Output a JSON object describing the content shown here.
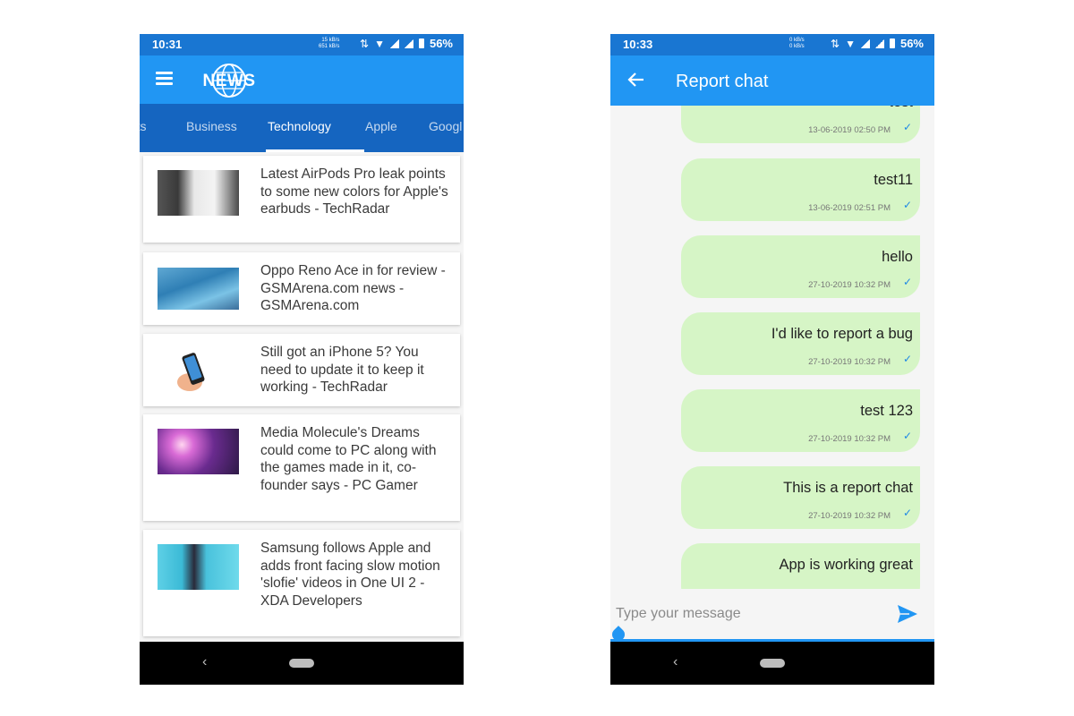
{
  "left": {
    "status": {
      "time": "10:31",
      "net_up": "15 kB/s",
      "net_down": "651 kB/s",
      "battery": "56%"
    },
    "app": {
      "logo_text": "NEWS"
    },
    "tabs": [
      "rts",
      "Business",
      "Technology",
      "Apple",
      "Googl"
    ],
    "active_tab": "Technology",
    "articles": [
      {
        "title": "Latest AirPods Pro leak points to some new colors for Apple's earbuds - TechRadar"
      },
      {
        "title": "Oppo Reno Ace in for review - GSMArena.com news - GSMArena.com"
      },
      {
        "title": "Still got an iPhone 5? You need to update it to keep it working - TechRadar"
      },
      {
        "title": "Media Molecule's Dreams could come to PC along with the games made in it, co-founder says - PC Gamer"
      },
      {
        "title": "Samsung follows Apple and adds front facing slow motion 'slofie' videos in One UI 2 - XDA Developers"
      }
    ],
    "nav": {
      "back": "‹"
    }
  },
  "right": {
    "status": {
      "time": "10:33",
      "net_up": "0 kB/s",
      "net_down": "0 kB/s",
      "battery": "56%"
    },
    "header": {
      "title": "Report chat"
    },
    "messages": [
      {
        "text": "test",
        "time": "13-06-2019   02:50 PM"
      },
      {
        "text": "test11",
        "time": "13-06-2019   02:51 PM"
      },
      {
        "text": "hello",
        "time": "27-10-2019   10:32 PM"
      },
      {
        "text": "I'd like to report a bug",
        "time": "27-10-2019   10:32 PM"
      },
      {
        "text": "test 123",
        "time": "27-10-2019   10:32 PM"
      },
      {
        "text": "This is a report chat",
        "time": "27-10-2019   10:32 PM"
      },
      {
        "text": "App is working great",
        "time": ""
      }
    ],
    "composer": {
      "placeholder": "Type your message",
      "value": ""
    },
    "nav": {
      "back": "‹"
    }
  },
  "colors": {
    "primary": "#2196f3",
    "primary_dark": "#1976d2",
    "tab_bar": "#1565c0",
    "bubble": "#d6f5c6",
    "check": "#1e88e5"
  }
}
